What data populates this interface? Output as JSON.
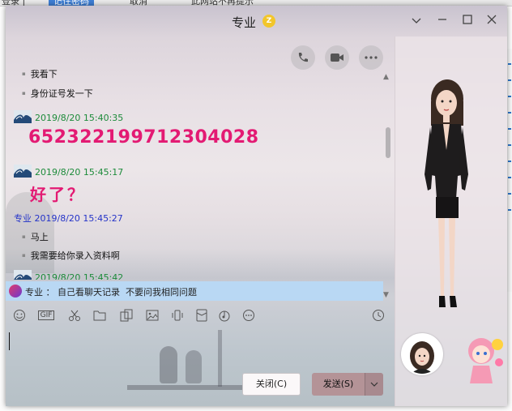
{
  "background_app": {
    "top_tabs": [
      "登录 |",
      "记住密码",
      "取消",
      "此网站不再提示"
    ]
  },
  "window": {
    "title": "专业",
    "badge": "Z"
  },
  "messages": [
    {
      "kind": "text",
      "text": "我看下"
    },
    {
      "kind": "text",
      "text": "身份证号发一下"
    },
    {
      "kind": "header",
      "avatar": true,
      "sender": "",
      "timestamp": "2019/8/20 15:40:35",
      "color": "#1c8b3a"
    },
    {
      "kind": "big",
      "text": "652322199712304028"
    },
    {
      "kind": "header",
      "avatar": true,
      "sender": "",
      "timestamp": "2019/8/20 15:45:17",
      "color": "#1c8b3a"
    },
    {
      "kind": "big",
      "text": "好了？"
    },
    {
      "kind": "header",
      "avatar": false,
      "sender": "专业",
      "timestamp": "2019/8/20 15:45:27",
      "color": "#2433c8"
    },
    {
      "kind": "text",
      "text": "马上"
    },
    {
      "kind": "text",
      "text": "我需要给你录入资料啊"
    },
    {
      "kind": "header",
      "avatar": true,
      "sender": "",
      "timestamp": "2019/8/20 15:45:42",
      "color": "#1c8b3a"
    }
  ],
  "notice": {
    "text": "专业 ： 自己看聊天记录  不要问我相同问题"
  },
  "toolbar": {
    "icons": [
      "smile-icon",
      "gif-icon",
      "scissors-icon",
      "folder-icon",
      "sticker-icon",
      "image-icon",
      "shake-icon",
      "red-packet-icon",
      "music-icon",
      "more-icon",
      "history-icon"
    ],
    "gif_label": "GIF"
  },
  "buttons": {
    "close_label": "关闭(C)",
    "send_label": "发送(S)"
  },
  "colors": {
    "accent_send": "#b49397",
    "notice_bg": "#b9d8f4",
    "big_text": "#e31a73"
  }
}
